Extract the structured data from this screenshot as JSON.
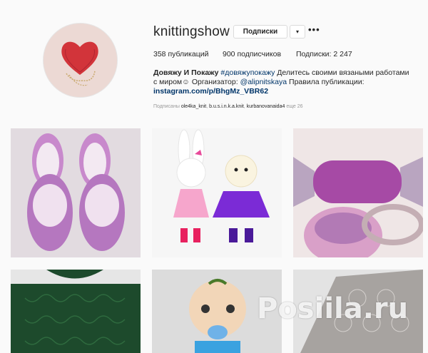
{
  "profile": {
    "username": "knittingshow",
    "follow_label": "Подписки",
    "dropdown_label": "▾",
    "more_label": "•••"
  },
  "stats": {
    "posts": "358",
    "posts_label": "публикаций",
    "followers": "900",
    "followers_label": "подписчиков",
    "following_label": "Подписки:",
    "following": "2 247"
  },
  "bio": {
    "name": "Довяжу И Покажу",
    "hashtag": "#довяжупокажу",
    "text1": "Делитесь своими вязаными работами с миром",
    "emoji": "☺",
    "text2": "Организатор:",
    "mention": "@alipnitskaya",
    "text3": "Правила публикации:",
    "link": "instagram.com/p/BhgMz_VBR62"
  },
  "followed_by": {
    "label": "Подписаны",
    "users": [
      "ole4ka_knit",
      "b.u.s.i.n.k.a.knit",
      "kurbanovanaida4"
    ],
    "more": "еще 26"
  },
  "posts": [
    {
      "subject": "crochet-slippers"
    },
    {
      "subject": "knitted-bunny-toys"
    },
    {
      "subject": "knitted-candy-bag"
    },
    {
      "subject": "green-knit-sweater"
    },
    {
      "subject": "crochet-baby-doll"
    },
    {
      "subject": "lace-shawl"
    }
  ],
  "watermark": "Posiila.ru",
  "colors": {
    "link": "#003569",
    "background": "#fafafa"
  }
}
